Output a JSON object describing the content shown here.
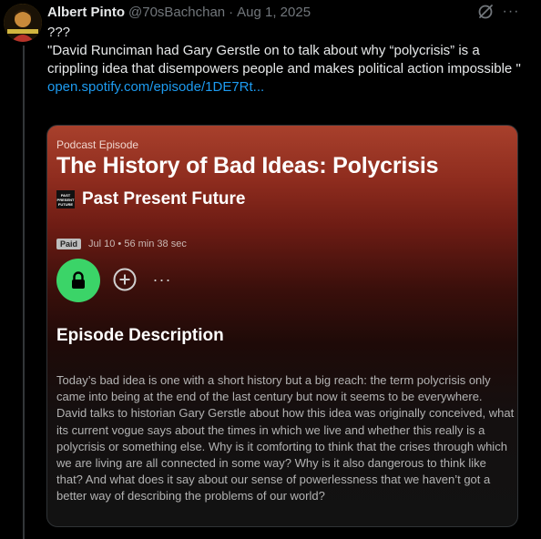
{
  "tweet": {
    "author_name": "Albert Pinto",
    "handle": "@70sBachchan",
    "separator": "·",
    "date": "Aug 1, 2025",
    "line1": "???",
    "quote": "\"David Runciman had Gary Gerstle on to talk about why “polycrisis” is a crippling idea that disempowers people and makes political action impossible \"",
    "link_text": "open.spotify.com/episode/1DE7Rt...",
    "more_icon": "more-horizontal-icon",
    "grok_icon": "grok-icon"
  },
  "card": {
    "kind": "Podcast Episode",
    "title": "The History of Bad Ideas: Polycrisis",
    "show_logo_text": "PAST PRESENT FUTURE",
    "show_name": "Past Present Future",
    "paid_label": "Paid",
    "meta": "Jul 10 • 56 min 38 sec",
    "section_heading": "Episode Description",
    "description": "Today’s bad idea is one with a short history but a big reach: the term polycrisis only came into being at the end of the last century but now it seems to be everywhere. David talks to historian Gary Gerstle about how this idea was originally conceived, what its current vogue says about the times in which we live and whether this really is a polycrisis or something else. Why is it comforting to think that the crises through which we are living are all connected in some way? Why is it also dangerous to think like that? And what does it say about our sense of powerlessness that we haven’t got a better way of describing the problems of our world?",
    "more_glyph": "···",
    "accent_color": "#3bd468"
  }
}
